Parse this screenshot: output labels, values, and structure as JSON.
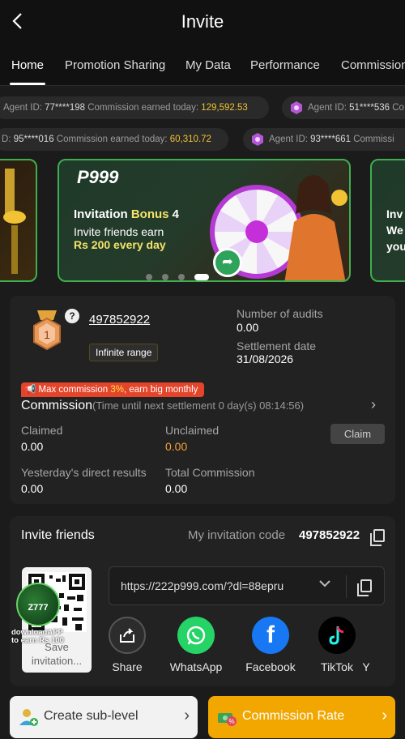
{
  "header": {
    "title": "Invite",
    "back_label": "<"
  },
  "tabs": [
    "Home",
    "Promotion Sharing",
    "My Data",
    "Performance",
    "Commission"
  ],
  "tickers": [
    {
      "prefix": "Agent ID: ",
      "id": "77****198",
      "mid": " Commission earned today: ",
      "amount": "129,592.53"
    },
    {
      "prefix": "Agent ID: ",
      "id": "51****536",
      "mid": " Co",
      "amount": ""
    },
    {
      "prefix": "D: ",
      "id": "95****016",
      "mid": " Commission earned today: ",
      "amount": "60,310.72"
    },
    {
      "prefix": "Agent ID: ",
      "id": "93****661",
      "mid": " Commissi",
      "amount": ""
    }
  ],
  "banner": {
    "brand": "P999",
    "line1_a": "Invitation ",
    "line1_b": "Bonus",
    "line1_c": " 4",
    "line2": "Invite friends earn",
    "line3": "Rs 200 every day",
    "right_text": "Inv\nWe\nyou"
  },
  "agent": {
    "rank": "1",
    "help": "?",
    "id": "497852922",
    "range": "Infinite range",
    "audits_label": "Number of audits",
    "audits_value": "0.00",
    "settlement_label": "Settlement date",
    "settlement_value": "31/08/2026"
  },
  "commission": {
    "promo_a": "Max commission ",
    "promo_pct": "3%",
    "promo_b": ", earn big monthly",
    "title": "Commission",
    "subtitle": "(Time until next settlement  0 day(s) 08:14:56)",
    "claimed_label": "Claimed",
    "claimed_value": "0.00",
    "unclaimed_label": "Unclaimed",
    "unclaimed_value": "0.00",
    "claim_button": "Claim",
    "yesterday_label": "Yesterday's direct results",
    "yesterday_value": "0.00",
    "total_label": "Total Commission",
    "total_value": "0.00"
  },
  "invite": {
    "title": "Invite friends",
    "code_label": "My invitation code",
    "code": "497852922",
    "qr_label": "Save invitation...",
    "badge_text": "Z777",
    "download_text_1": "downloadAPP",
    "download_text_2": "to earn Rs 100",
    "link": "https://222p999.com/?dl=88epru",
    "share": [
      {
        "label": "Share",
        "icon": "share-icon",
        "color": "#2c2c2c"
      },
      {
        "label": "WhatsApp",
        "icon": "whatsapp-icon",
        "color": "#25d366"
      },
      {
        "label": "Facebook",
        "icon": "facebook-icon",
        "color": "#1877f2"
      },
      {
        "label": "TikTok",
        "icon": "tiktok-icon",
        "color": "#000000"
      },
      {
        "label": "Y",
        "icon": "more-icon",
        "color": "#222222"
      }
    ]
  },
  "buttons": {
    "create_sub": "Create sub-level",
    "commission_rate": "Commission Rate"
  }
}
